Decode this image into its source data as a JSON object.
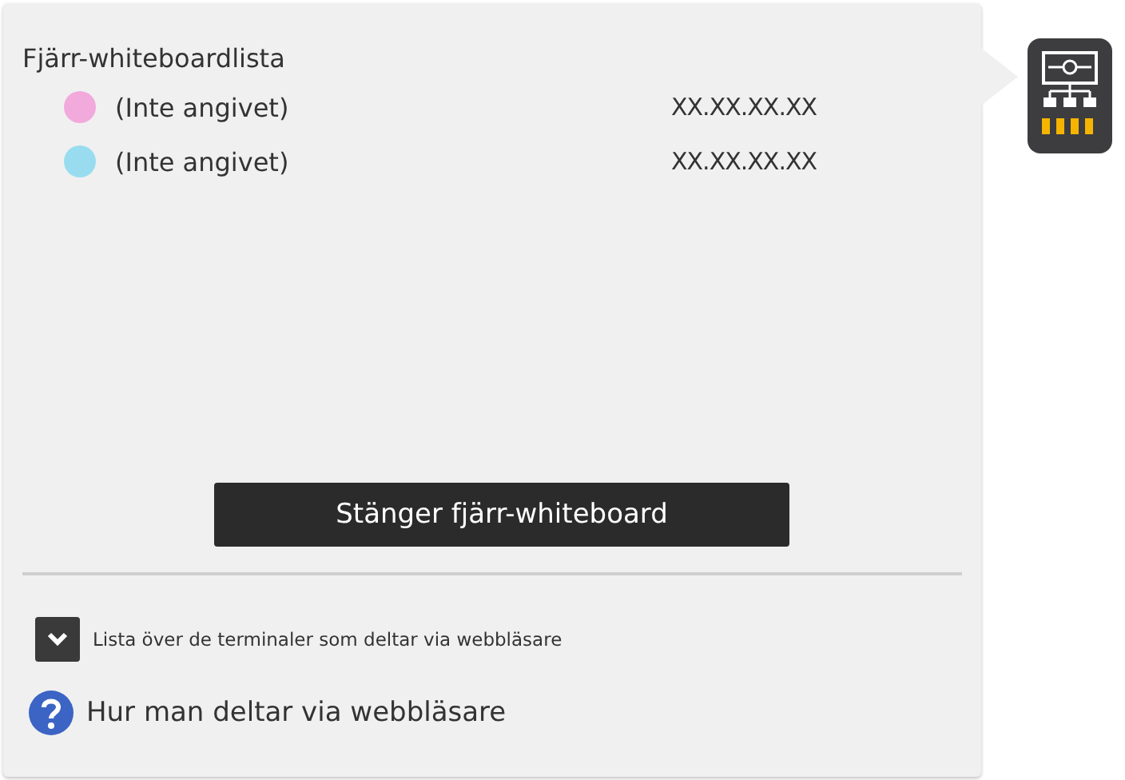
{
  "panel": {
    "title": "Fjärr-whiteboardlista",
    "devices": [
      {
        "name": "(Inte angivet)",
        "address": "XX.XX.XX.XX",
        "color": "#f2a9dc"
      },
      {
        "name": "(Inte angivet)",
        "address": "XX.XX.XX.XX",
        "color": "#99dcf0"
      }
    ],
    "close_button": "Stänger fjärr-whiteboard",
    "browser_list": {
      "label": "Lista över de terminaler som deltar via webbläsare",
      "expanded": false
    },
    "help_link": "Hur man deltar via webbläsare"
  }
}
